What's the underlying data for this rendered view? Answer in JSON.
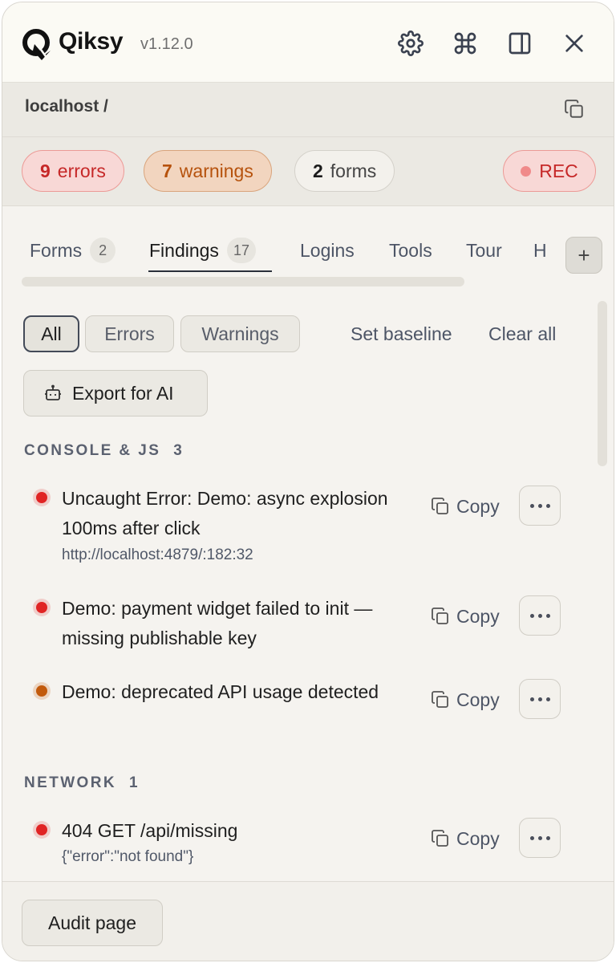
{
  "app": {
    "name": "Qiksy",
    "version": "v1.12.0",
    "icons": [
      "qiksy-logo",
      "gear-icon",
      "command-icon",
      "sidebar-panel-icon",
      "close-icon"
    ]
  },
  "url": {
    "text": "localhost /",
    "copy_icon": "copy-icon"
  },
  "stats": {
    "errors": {
      "count": "9",
      "label": "errors"
    },
    "warnings": {
      "count": "7",
      "label": "warnings"
    },
    "forms": {
      "count": "2",
      "label": "forms"
    },
    "rec_label": "REC"
  },
  "tabs": [
    {
      "label": "Forms",
      "count": "2"
    },
    {
      "label": "Findings",
      "count": "17",
      "active": true
    },
    {
      "label": "Logins"
    },
    {
      "label": "Tools"
    },
    {
      "label": "Tour"
    },
    {
      "label": "H"
    }
  ],
  "tab_add_label": "+",
  "filters": {
    "all": "All",
    "errors": "Errors",
    "warnings": "Warnings",
    "set_baseline": "Set baseline",
    "clear_all": "Clear all",
    "selected": "All"
  },
  "export_label": "Export for AI",
  "sections": [
    {
      "title": "CONSOLE & JS",
      "count": "3",
      "items": [
        {
          "severity": "error",
          "text": "Uncaught Error: Demo: async explosion 100ms after click",
          "sub": "http://localhost:4879/:182:32"
        },
        {
          "severity": "error",
          "text": "Demo: payment widget failed to init — missing publishable key",
          "sub": ""
        },
        {
          "severity": "warning",
          "text": "Demo: deprecated API usage detected",
          "sub": ""
        }
      ]
    },
    {
      "title": "NETWORK",
      "count": "1",
      "items": [
        {
          "severity": "error",
          "text": "404 GET /api/missing",
          "sub": "{\"error\":\"not found\"}"
        }
      ]
    }
  ],
  "copy_label": "Copy",
  "footer": {
    "audit_label": "Audit page"
  },
  "colors": {
    "error": "#e02424",
    "warning": "#c25a0c",
    "accent": "#2a2f3a"
  }
}
